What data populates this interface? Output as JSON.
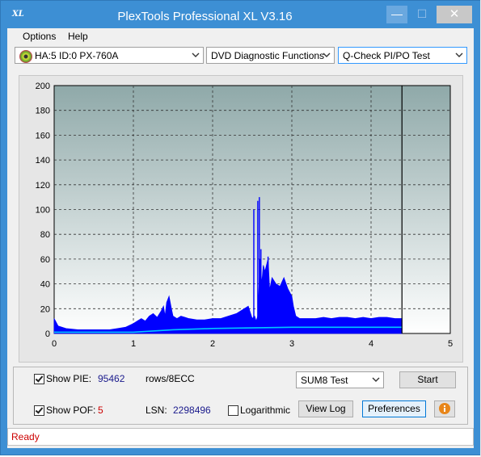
{
  "window": {
    "title": "PlexTools Professional XL V3.16",
    "app_icon": "XL",
    "controls": {
      "minimize": "—",
      "maximize": "☐",
      "close": "✕"
    }
  },
  "menu": {
    "options": "Options",
    "help": "Help"
  },
  "toolbar": {
    "drive": "HA:5 ID:0  PX-760A",
    "function": "DVD Diagnostic Functions",
    "test": "Q-Check PI/PO Test",
    "drive_icon": "disc-icon"
  },
  "chart_data": {
    "type": "area",
    "x_ticks": [
      "0",
      "1",
      "2",
      "3",
      "4",
      "5"
    ],
    "y_ticks": [
      "0",
      "20",
      "40",
      "60",
      "80",
      "100",
      "120",
      "140",
      "160",
      "180",
      "200"
    ],
    "xlim": [
      0,
      5
    ],
    "ylim": [
      0,
      200
    ],
    "grid": true,
    "end_marker_x": 4.39,
    "series": [
      {
        "color": "#0000ff",
        "points": [
          [
            0,
            12
          ],
          [
            0.05,
            6
          ],
          [
            0.15,
            4
          ],
          [
            0.3,
            3
          ],
          [
            0.5,
            3
          ],
          [
            0.7,
            3
          ],
          [
            0.8,
            4
          ],
          [
            0.9,
            5
          ],
          [
            1.0,
            8
          ],
          [
            1.05,
            10
          ],
          [
            1.1,
            12
          ],
          [
            1.15,
            10
          ],
          [
            1.2,
            14
          ],
          [
            1.25,
            16
          ],
          [
            1.3,
            13
          ],
          [
            1.35,
            18
          ],
          [
            1.38,
            22
          ],
          [
            1.4,
            14
          ],
          [
            1.42,
            25
          ],
          [
            1.45,
            30
          ],
          [
            1.48,
            20
          ],
          [
            1.5,
            14
          ],
          [
            1.55,
            12
          ],
          [
            1.6,
            14
          ],
          [
            1.65,
            13
          ],
          [
            1.7,
            12
          ],
          [
            1.8,
            11
          ],
          [
            1.9,
            11
          ],
          [
            2.0,
            12
          ],
          [
            2.1,
            12
          ],
          [
            2.2,
            14
          ],
          [
            2.3,
            16
          ],
          [
            2.4,
            20
          ],
          [
            2.45,
            22
          ],
          [
            2.5,
            12
          ],
          [
            2.53,
            14
          ],
          [
            2.55,
            10
          ],
          [
            2.57,
            14
          ],
          [
            2.6,
            60
          ],
          [
            2.62,
            40
          ],
          [
            2.64,
            55
          ],
          [
            2.66,
            50
          ],
          [
            2.7,
            60
          ],
          [
            2.72,
            35
          ],
          [
            2.75,
            45
          ],
          [
            2.8,
            40
          ],
          [
            2.85,
            38
          ],
          [
            2.9,
            45
          ],
          [
            2.95,
            36
          ],
          [
            3.0,
            30
          ],
          [
            3.02,
            22
          ],
          [
            3.05,
            14
          ],
          [
            3.1,
            12
          ],
          [
            3.2,
            12
          ],
          [
            3.3,
            12
          ],
          [
            3.4,
            13
          ],
          [
            3.5,
            12
          ],
          [
            3.6,
            13
          ],
          [
            3.7,
            13
          ],
          [
            3.8,
            12
          ],
          [
            3.9,
            13
          ],
          [
            4.0,
            12
          ],
          [
            4.1,
            13
          ],
          [
            4.2,
            13
          ],
          [
            4.3,
            12
          ],
          [
            4.39,
            12
          ]
        ],
        "spikes": [
          [
            2.52,
            100
          ],
          [
            2.57,
            107
          ],
          [
            2.59,
            110
          ],
          [
            2.61,
            68
          ],
          [
            2.68,
            53
          ],
          [
            2.7,
            62
          ]
        ]
      },
      {
        "color": "#00c8ff",
        "points": [
          [
            0,
            1
          ],
          [
            1,
            1
          ],
          [
            1.5,
            3
          ],
          [
            2.0,
            4
          ],
          [
            2.5,
            4.5
          ],
          [
            3.0,
            5
          ],
          [
            3.5,
            5
          ],
          [
            4.0,
            5
          ],
          [
            4.39,
            5
          ]
        ]
      }
    ]
  },
  "panel": {
    "show_pie_label": "Show PIE:",
    "pie_value": "95462",
    "pie_unit": "rows/8ECC",
    "show_poe_label": "Show POF:",
    "poe_value": "5",
    "lsn_label": "LSN:",
    "lsn_value": "2298496",
    "log_label": "Logarithmic",
    "sum_select": "SUM8 Test",
    "start_button": "Start",
    "viewlog_button": "View Log",
    "prefs_button": "Preferences",
    "info_icon": "info-icon"
  },
  "status": {
    "text": "Ready"
  }
}
